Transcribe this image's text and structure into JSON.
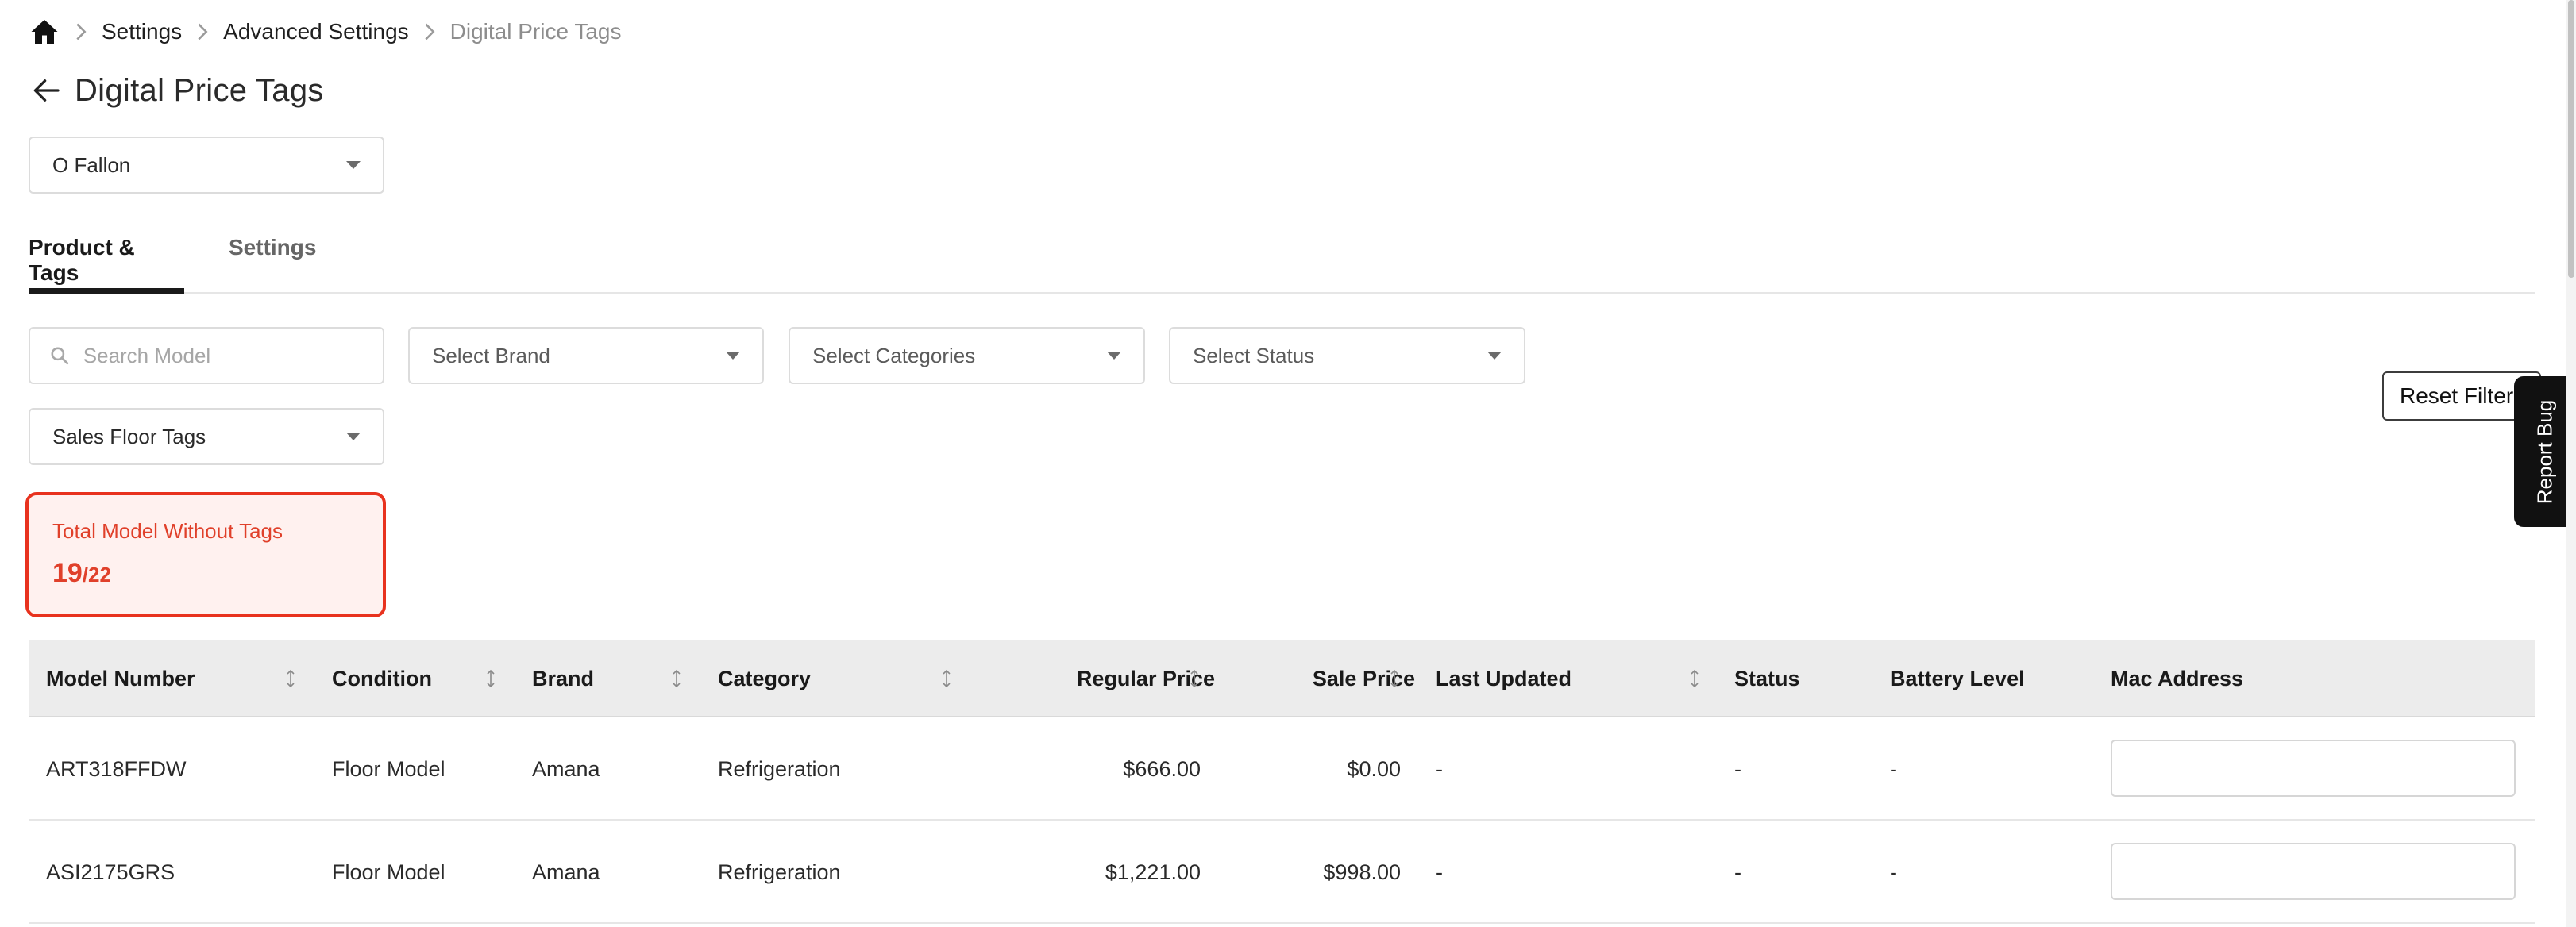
{
  "breadcrumb": {
    "items": [
      "Settings",
      "Advanced Settings",
      "Digital Price Tags"
    ]
  },
  "page": {
    "title": "Digital Price Tags"
  },
  "location_select": {
    "value": "O Fallon"
  },
  "tabs": [
    {
      "label": "Product & Tags",
      "active": true
    },
    {
      "label": "Settings",
      "active": false
    }
  ],
  "filters": {
    "search_placeholder": "Search Model",
    "brand": "Select Brand",
    "categories": "Select Categories",
    "status": "Select Status",
    "tag_type": "Sales Floor Tags",
    "reset_label": "Reset Filter"
  },
  "report_bug_label": "Report Bug",
  "summary": {
    "title": "Total Model Without Tags",
    "count": "19",
    "total": "/22"
  },
  "table": {
    "columns": [
      "Model Number",
      "Condition",
      "Brand",
      "Category",
      "Regular Price",
      "Sale Price",
      "Last Updated",
      "Status",
      "Battery Level",
      "Mac Address"
    ],
    "rows": [
      [
        "ART318FFDW",
        "Floor Model",
        "Amana",
        "Refrigeration",
        "$666.00",
        "$0.00",
        "-",
        "-",
        "-",
        ""
      ],
      [
        "ASI2175GRS",
        "Floor Model",
        "Amana",
        "Refrigeration",
        "$1,221.00",
        "$998.00",
        "-",
        "-",
        "-",
        ""
      ]
    ]
  },
  "colors": {
    "alert": "#e8321e",
    "alert_bg": "#fff1ef",
    "header_bg": "#ececec",
    "active_tab": "#1a1a1a"
  }
}
